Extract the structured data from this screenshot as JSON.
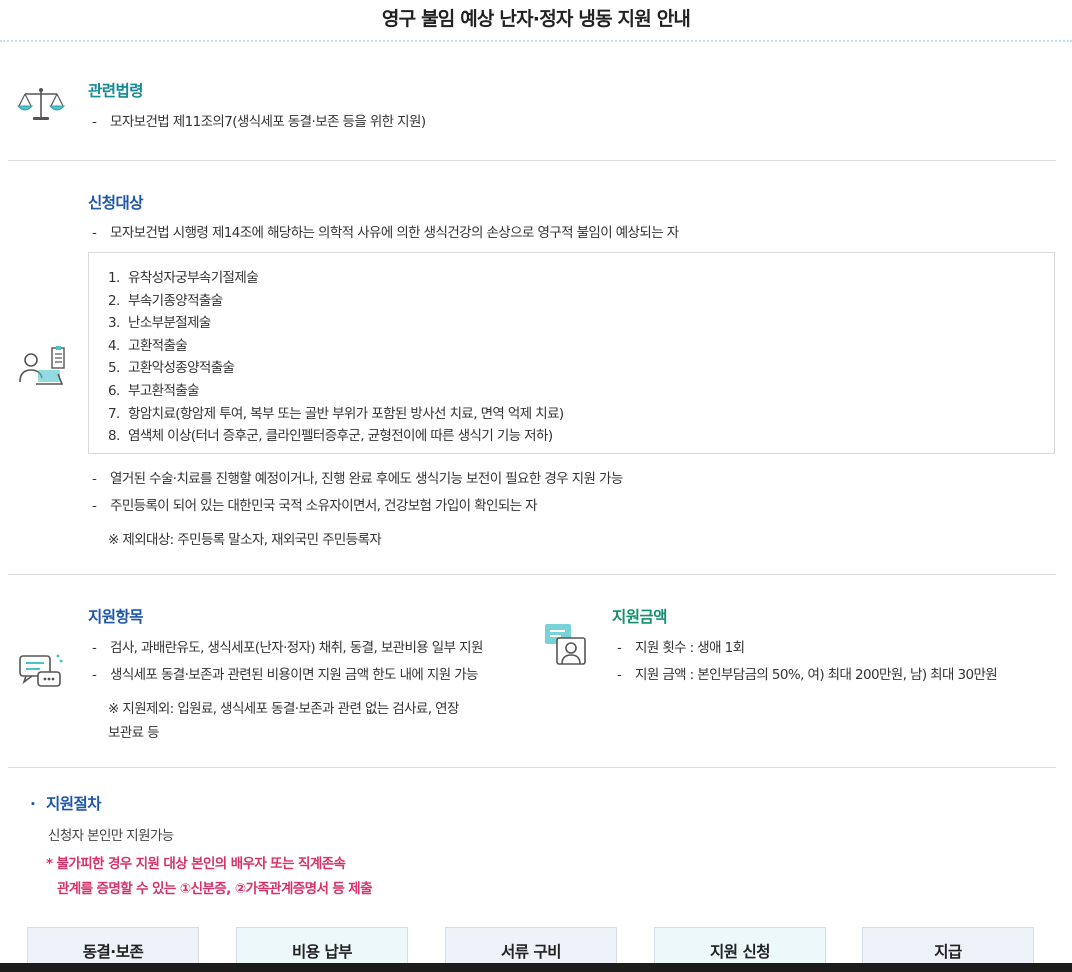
{
  "title": "영구 불임 예상 난자·정자 냉동 지원 안내",
  "law": {
    "heading": "관련법령",
    "item": "모자보건법 제11조의7(생식세포 동결·보존 등을 위한 지원)"
  },
  "target": {
    "heading": "신청대상",
    "intro": "모자보건법 시행령 제14조에 해당하는 의학적 사유에 의한 생식건강의 손상으로 영구적 불임이 예상되는 자",
    "list": [
      {
        "num": "1.",
        "text": "유착성자궁부속기절제술"
      },
      {
        "num": "2.",
        "text": "부속기종양적출술"
      },
      {
        "num": "3.",
        "text": "난소부분절제술"
      },
      {
        "num": "4.",
        "text": "고환적출술"
      },
      {
        "num": "5.",
        "text": "고환악성종양적출술"
      },
      {
        "num": "6.",
        "text": "부고환적출술"
      },
      {
        "num": "7.",
        "text": "항암치료(항암제 투여, 복부 또는 골반 부위가 포함된 방사선 치료, 면역 억제 치료)"
      },
      {
        "num": "8.",
        "text": "염색체 이상(터너 증후군, 클라인펠터증후군, 균형전이에 따른 생식기 기능 저하)"
      }
    ],
    "after1": "열거된 수술·치료를 진행할 예정이거나, 진행 완료 후에도 생식기능 보전이 필요한 경우 지원 가능",
    "after2": "주민등록이 되어 있는 대한민국 국적 소유자이면서, 건강보험 가입이 확인되는 자",
    "exclude": "※ 제외대상: 주민등록 말소자, 재외국민 주민등록자"
  },
  "items": {
    "heading": "지원항목",
    "line1": "검사, 과배란유도, 생식세포(난자·정자) 채취, 동결, 보관비용 일부 지원",
    "line2": "생식세포 동결·보존과 관련된 비용이면 지원 금액 한도 내에 지원 가능",
    "note1": "※ 지원제외: 입원료, 생식세포 동결·보존과 관련 없는 검사료, 연장",
    "note2": "보관료 등"
  },
  "amount": {
    "heading": "지원금액",
    "line1": "지원 횟수 : 생애 1회",
    "line2": "지원 금액 : 본인부담금의 50%, 여) 최대 200만원, 남) 최대 30만원"
  },
  "procedure": {
    "bullet": "·",
    "heading": "지원절차",
    "sub": "신청자 본인만 지원가능",
    "note1": "* 불가피한 경우 지원 대상 본인의 배우자 또는 직계존속",
    "note2": "관계를 증명할 수 있는 ①신분증, ②가족관계증명서 등 제출",
    "steps": [
      "동결·보존",
      "비용 납부",
      "서류 구비",
      "지원 신청",
      "지급"
    ]
  },
  "dash": "-",
  "colors": {
    "teal": "#138a94",
    "blue": "#1f57a8",
    "green": "#15906e",
    "pink": "#d6336c",
    "icon_fill": "#4cc3c9"
  },
  "icons": [
    "scales-icon",
    "person-laptop-document-icon",
    "chat-bubbles-icon",
    "video-consult-icon"
  ]
}
